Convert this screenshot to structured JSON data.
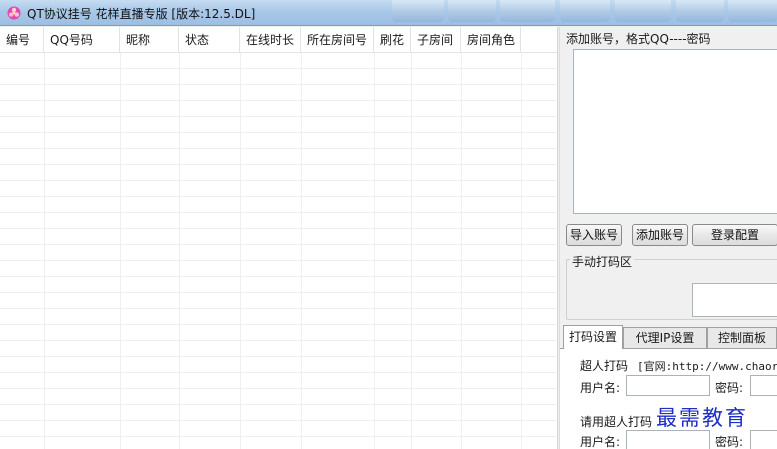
{
  "window": {
    "title": "QT协议挂号 花样直播专版 [版本:12.5.DL]",
    "icon": "app-logo-icon"
  },
  "table": {
    "columns": [
      "编号",
      "QQ号码",
      "昵称",
      "状态",
      "在线时长",
      "所在房间号",
      "刷花",
      "子房间",
      "房间角色"
    ],
    "rows": []
  },
  "accounts": {
    "label": "添加账号，格式QQ----密码",
    "value": ""
  },
  "buttons": {
    "import": "导入账号",
    "add": "添加账号",
    "login_config": "登录配置"
  },
  "captcha": {
    "group_title": "手动打码区"
  },
  "tabs": [
    {
      "label": "打码设置",
      "active": true
    },
    {
      "label": "代理IP设置",
      "active": false
    },
    {
      "label": "控制面板",
      "active": false
    }
  ],
  "coding_settings": {
    "chaoren_label": "超人打码",
    "chaoren_site": "[官网:http://www.chaoren",
    "username_label": "用户名:",
    "password_label": "密码:",
    "enable_chaoren_label": "请用超人打码",
    "username_label_2": "用户名:",
    "password_label_2": "密码:"
  },
  "watermark": "最需教育"
}
